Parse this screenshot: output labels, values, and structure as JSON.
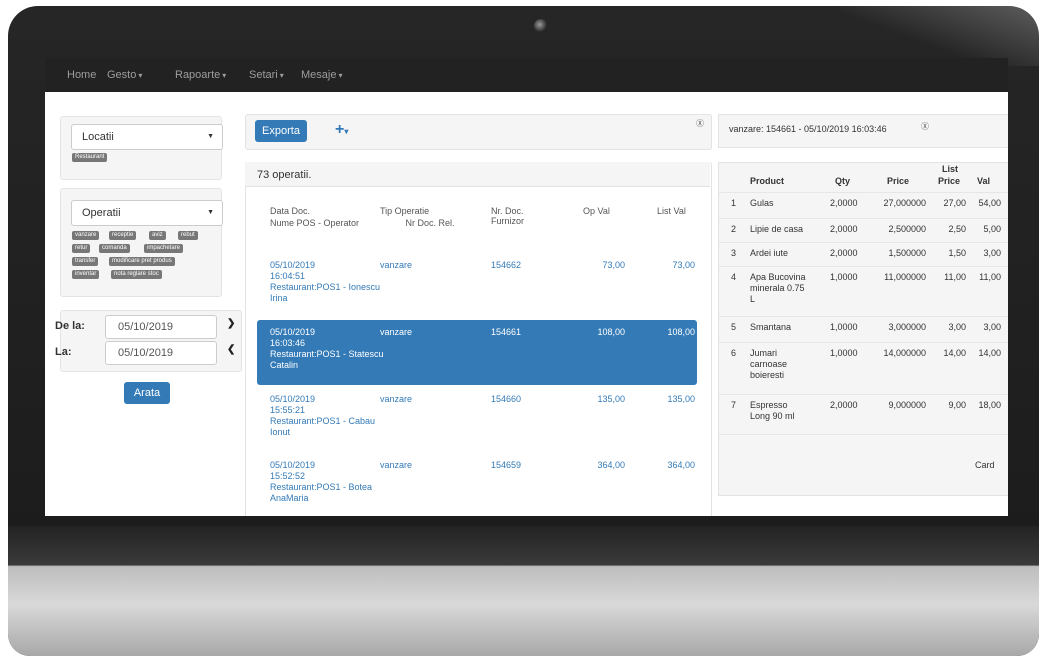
{
  "nav": [
    {
      "label": "Home",
      "dropdown": false
    },
    {
      "label": "Gesto",
      "dropdown": true
    },
    {
      "label": "Rapoarte",
      "dropdown": true
    },
    {
      "label": "Setari",
      "dropdown": true
    },
    {
      "label": "Mesaje",
      "dropdown": true
    }
  ],
  "sidebar": {
    "locatii": {
      "label": "Locatii",
      "tags": [
        "Restaurant"
      ]
    },
    "operatii": {
      "label": "Operatii",
      "tags": [
        "vanzare",
        "receptie",
        "aviz",
        "rebut",
        "retur",
        "comanda",
        "impachetare",
        "transfer",
        "modificare pret produs",
        "inventar",
        "nota reglare stoc"
      ]
    },
    "de_la": {
      "label": "De la:",
      "value": "05/10/2019"
    },
    "la": {
      "label": "La:",
      "value": "05/10/2019"
    },
    "arata": "Arata"
  },
  "toolbar": {
    "export": "Exporta",
    "add": "+"
  },
  "ops": {
    "count": "73 operatii.",
    "headers": {
      "data": "Data Doc.",
      "nume": "Nume POS - Operator",
      "tip": "Tip Operatie",
      "nrrel": "Nr Doc. Rel.",
      "nr": "Nr. Doc. Furnizor",
      "op": "Op Val",
      "list": "List Val"
    },
    "rows": [
      {
        "date": "05/10/2019",
        "time": "16:04:51",
        "pos": "Restaurant:POS1 - Ionescu",
        "op2": "Irina",
        "tip": "vanzare",
        "nr": "154662",
        "opval": "73,00",
        "listval": "73,00"
      },
      {
        "date": "05/10/2019",
        "time": "16:03:46",
        "pos": "Restaurant:POS1 - Statescu",
        "op2": "Catalin",
        "tip": "vanzare",
        "nr": "154661",
        "opval": "108,00",
        "listval": "108,00"
      },
      {
        "date": "05/10/2019",
        "time": "15:55:21",
        "pos": "Restaurant:POS1 - Cabau",
        "op2": "Ionut",
        "tip": "vanzare",
        "nr": "154660",
        "opval": "135,00",
        "listval": "135,00"
      },
      {
        "date": "05/10/2019",
        "time": "15:52:52",
        "pos": "Restaurant:POS1 - Botea",
        "op2": "AnaMaria",
        "tip": "vanzare",
        "nr": "154659",
        "opval": "364,00",
        "listval": "364,00"
      }
    ]
  },
  "detail": {
    "title": "vanzare: 154661 - 05/10/2019 16:03:46",
    "headers": {
      "product": "Product",
      "qty": "Qty",
      "price": "Price",
      "list1": "List",
      "list2": "Price",
      "val": "Val"
    },
    "rows": [
      {
        "n": "1",
        "p": [
          "Gulas"
        ],
        "qty": "2,0000",
        "price": "27,000000",
        "list": "27,00",
        "val": "54,00"
      },
      {
        "n": "2",
        "p": [
          "Lipie de casa"
        ],
        "qty": "2,0000",
        "price": "2,500000",
        "list": "2,50",
        "val": "5,00"
      },
      {
        "n": "3",
        "p": [
          "Ardei iute"
        ],
        "qty": "2,0000",
        "price": "1,500000",
        "list": "1,50",
        "val": "3,00"
      },
      {
        "n": "4",
        "p": [
          "Apa Bucovina",
          "minerala 0.75",
          "L"
        ],
        "qty": "1,0000",
        "price": "11,000000",
        "list": "11,00",
        "val": "11,00"
      },
      {
        "n": "5",
        "p": [
          "Smantana"
        ],
        "qty": "1,0000",
        "price": "3,000000",
        "list": "3,00",
        "val": "3,00"
      },
      {
        "n": "6",
        "p": [
          "Jumari",
          "carnoase",
          "boieresti"
        ],
        "qty": "1,0000",
        "price": "14,000000",
        "list": "14,00",
        "val": "14,00"
      },
      {
        "n": "7",
        "p": [
          "Espresso",
          "Long 90 ml"
        ],
        "qty": "2,0000",
        "price": "9,000000",
        "list": "9,00",
        "val": "18,00"
      }
    ],
    "payment": "Card"
  }
}
